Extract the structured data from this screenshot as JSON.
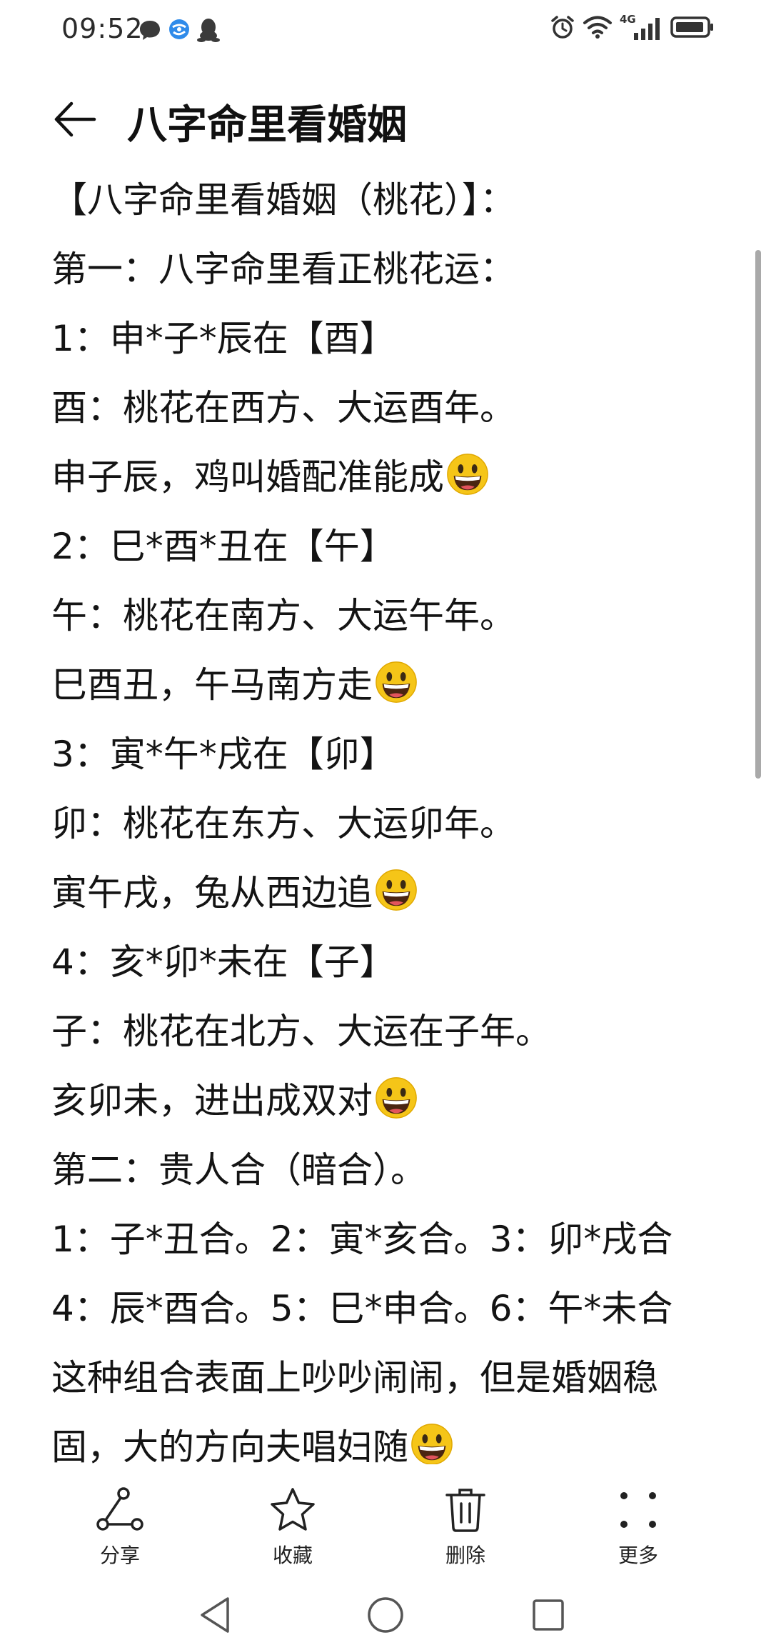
{
  "status_bar": {
    "time": "09:52",
    "network_label": "4G",
    "icons": [
      "chat-bubble-icon",
      "browser-icon",
      "qq-penguin-icon",
      "alarm-icon",
      "wifi-icon",
      "cellular-signal-icon",
      "battery-icon"
    ]
  },
  "header": {
    "back_icon": "arrow-left-icon",
    "title": "八字命里看婚姻"
  },
  "content": {
    "lines": [
      {
        "text": "【八字命里看婚姻（桃花）】：",
        "emoji": false
      },
      {
        "text": "第一：八字命里看正桃花运：",
        "emoji": false
      },
      {
        "text": "1：申*子*辰在【酉】",
        "emoji": false
      },
      {
        "text": "酉：桃花在西方、大运酉年。",
        "emoji": false
      },
      {
        "text": "申子辰，鸡叫婚配准能成",
        "emoji": true
      },
      {
        "text": "2：巳*酉*丑在【午】",
        "emoji": false
      },
      {
        "text": "午：桃花在南方、大运午年。",
        "emoji": false
      },
      {
        "text": "巳酉丑，午马南方走",
        "emoji": true
      },
      {
        "text": "3：寅*午*戌在【卯】",
        "emoji": false
      },
      {
        "text": "卯：桃花在东方、大运卯年。",
        "emoji": false
      },
      {
        "text": "寅午戌，兔从西边追",
        "emoji": true
      },
      {
        "text": "4：亥*卯*未在【子】",
        "emoji": false
      },
      {
        "text": "子：桃花在北方、大运在子年。",
        "emoji": false
      },
      {
        "text": "亥卯未，进出成双对",
        "emoji": true
      },
      {
        "text": "第二：贵人合（暗合）。",
        "emoji": false
      },
      {
        "text": "1：子*丑合。2：寅*亥合。3：卯*戌合",
        "emoji": false
      },
      {
        "text": "4：辰*酉合。5：巳*申合。6：午*未合",
        "emoji": false
      },
      {
        "text": "这种组合表面上吵吵闹闹，但是婚姻稳",
        "emoji": false
      },
      {
        "text": "固，大的方向夫唱妇随",
        "emoji": true
      }
    ],
    "emoji_icon": "grinning-face-emoji"
  },
  "toolbar": {
    "share_label": "分享",
    "favorite_label": "收藏",
    "delete_label": "删除",
    "more_label": "更多",
    "icons": [
      "share-icon",
      "star-icon",
      "trash-icon",
      "more-dots-icon"
    ]
  },
  "navigation": {
    "icons": [
      "back-triangle-icon",
      "home-circle-icon",
      "recents-square-icon"
    ]
  },
  "colors": {
    "background": "#ffffff",
    "text": "#141414",
    "scrollbar": "#a9a9a9",
    "emoji_face": "#f5c518",
    "notification_blue": "#2f8bea"
  }
}
